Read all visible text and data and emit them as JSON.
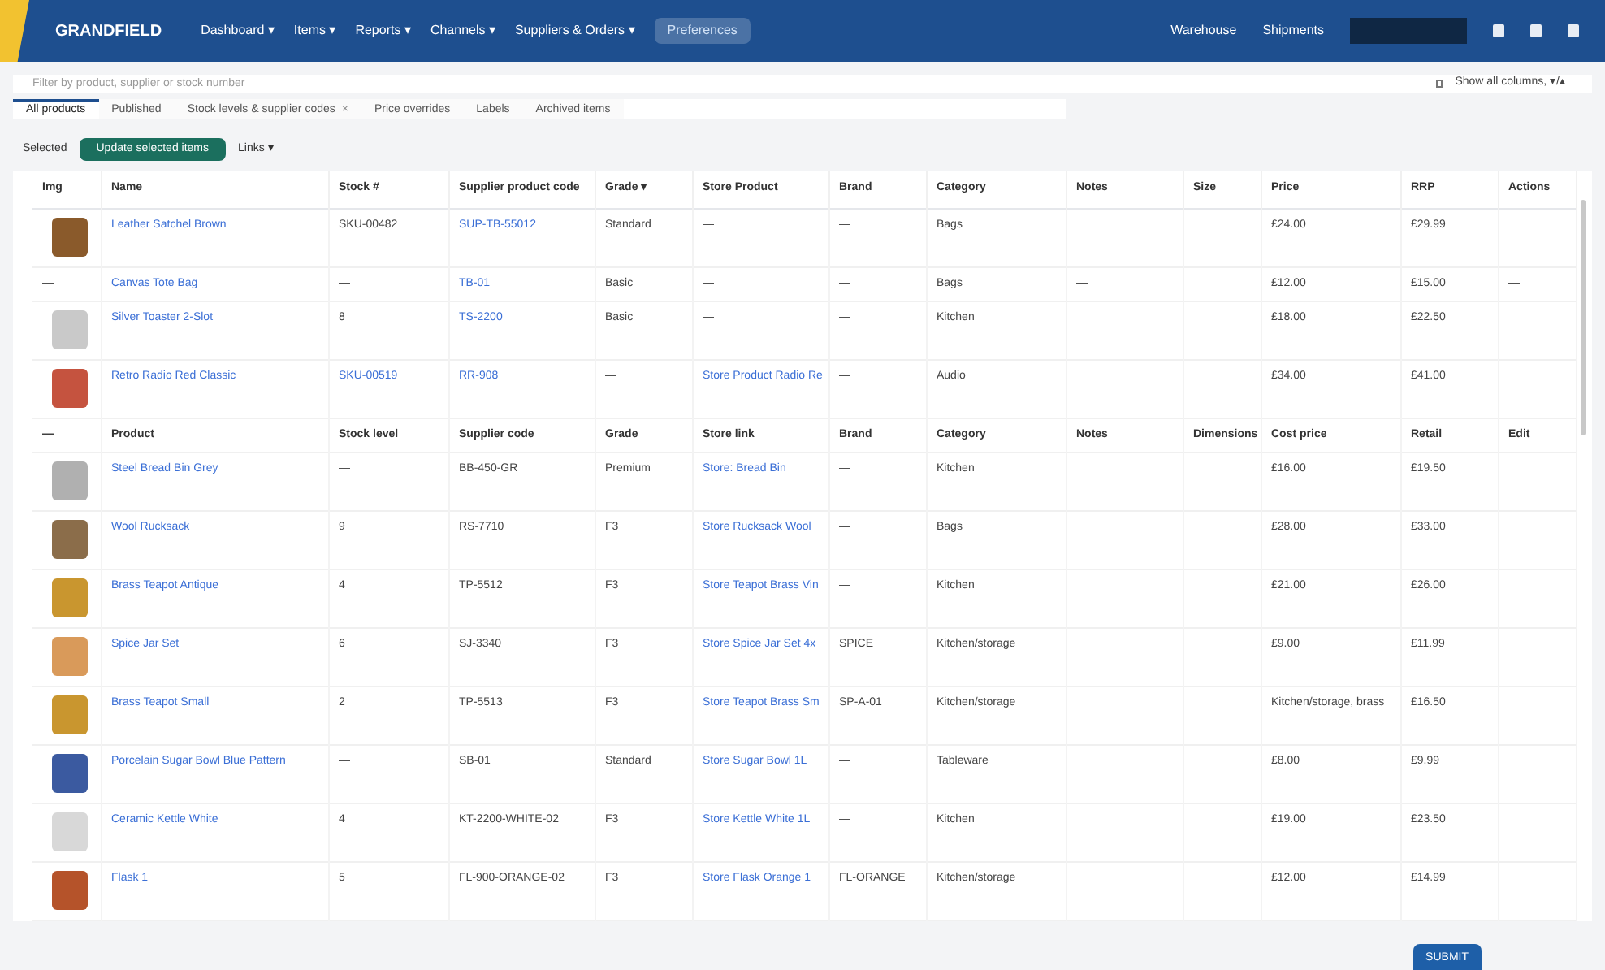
{
  "topbar": {
    "brand": "GRANDFIELD",
    "nav": [
      "Dashboard ▾",
      "Items ▾",
      "Reports ▾",
      "Channels ▾",
      "Suppliers & Orders ▾"
    ],
    "nav_pill": "Preferences",
    "links": [
      "Warehouse",
      "Shipments"
    ]
  },
  "search": {
    "placeholder": "Filter by product, supplier or stock number",
    "toggle": "Show all columns, ▾/▴"
  },
  "tabs": [
    {
      "label": "All products",
      "selected": true
    },
    {
      "label": "Published",
      "selected": false
    },
    {
      "label": "Stock levels & supplier codes",
      "selected": false,
      "close": "×"
    },
    {
      "label": "Price overrides",
      "selected": false
    },
    {
      "label": "Labels",
      "selected": false
    },
    {
      "label": "Archived items",
      "selected": false
    }
  ],
  "actions": {
    "label": "Selected",
    "button": "Update selected items",
    "menu": "Links ▾"
  },
  "table": {
    "columns": [
      "Img",
      "Name",
      "Stock #",
      "Supplier product code",
      "Grade ▾",
      "Store Product",
      "Brand",
      "Category",
      "Notes",
      "Size",
      "Price",
      "RRP",
      "Actions"
    ],
    "rows": [
      {
        "kind": "item",
        "photo": true,
        "cells": [
          null,
          {
            "text": "Leather Satchel Brown",
            "link": true
          },
          "SKU-00482",
          {
            "text": "SUP-TB-55012",
            "link": true
          },
          "Standard",
          "—",
          "—",
          "Bags",
          null,
          null,
          "£24.00",
          "£29.99",
          null
        ]
      },
      {
        "kind": "item",
        "photo": false,
        "cells": [
          "—",
          {
            "text": "Canvas Tote Bag",
            "link": true
          },
          "—",
          {
            "text": "TB-01",
            "link": true
          },
          "Basic",
          "—",
          "—",
          "Bags",
          "—",
          null,
          "£12.00",
          "£15.00",
          "—"
        ]
      },
      {
        "kind": "item",
        "photo": true,
        "cells": [
          null,
          {
            "text": "Silver Toaster 2-Slot",
            "link": true
          },
          "8",
          {
            "text": "TS-2200",
            "link": true
          },
          "Basic",
          "—",
          "—",
          "Kitchen",
          null,
          null,
          "£18.00",
          "£22.50",
          null
        ]
      },
      {
        "kind": "item",
        "photo": true,
        "cells": [
          null,
          {
            "text": "Retro Radio Red Classic",
            "link": true
          },
          {
            "text": "SKU-00519",
            "link": true
          },
          {
            "text": "RR-908",
            "link": true
          },
          "—",
          {
            "text": "Store Product Radio Re",
            "link": true
          },
          "—",
          "Audio",
          null,
          null,
          "£34.00",
          "£41.00",
          null
        ]
      },
      {
        "kind": "header",
        "photo": false,
        "cells": [
          "—",
          "Product",
          "Stock level",
          "Supplier code",
          "Grade",
          "Store link",
          "Brand",
          "Category",
          "Notes",
          "Dimensions",
          "Cost price",
          "Retail",
          "Edit"
        ]
      },
      {
        "kind": "item",
        "photo": true,
        "cells": [
          null,
          {
            "text": "Steel Bread Bin Grey",
            "link": true
          },
          "—",
          "BB-450-GR",
          "Premium",
          {
            "text": "Store: Bread Bin",
            "link": true
          },
          "—",
          "Kitchen",
          null,
          null,
          "£16.00",
          "£19.50",
          null
        ]
      },
      {
        "kind": "item",
        "photo": true,
        "cells": [
          null,
          {
            "text": "Wool Rucksack",
            "link": true
          },
          "9",
          "RS-7710",
          "F3",
          {
            "text": "Store Rucksack Wool",
            "link": true
          },
          "—",
          "Bags",
          null,
          null,
          "£28.00",
          "£33.00",
          null
        ]
      },
      {
        "kind": "item",
        "photo": true,
        "cells": [
          null,
          {
            "text": "Brass Teapot Antique",
            "link": true
          },
          "4",
          "TP-5512",
          "F3",
          {
            "text": "Store Teapot Brass Vin",
            "link": true
          },
          "—",
          "Kitchen",
          null,
          null,
          "£21.00",
          "£26.00",
          null
        ]
      },
      {
        "kind": "item",
        "photo": true,
        "cells": [
          null,
          {
            "text": "Spice Jar Set",
            "link": true
          },
          "6",
          "SJ-3340",
          "F3",
          {
            "text": "Store Spice Jar Set 4x",
            "link": true
          },
          "SPICE",
          "Kitchen/storage",
          null,
          null,
          "£9.00",
          "£11.99",
          null
        ]
      },
      {
        "kind": "item",
        "photo": true,
        "cells": [
          null,
          {
            "text": "Brass Teapot Small",
            "link": true
          },
          "2",
          "TP-5513",
          "F3",
          {
            "text": "Store Teapot Brass Sm",
            "link": true
          },
          "SP-A-01",
          "Kitchen/storage",
          null,
          null,
          "Kitchen/storage, brass",
          "£16.50",
          null
        ]
      },
      {
        "kind": "item",
        "photo": true,
        "cells": [
          null,
          {
            "text": "Porcelain Sugar Bowl Blue Pattern",
            "link": true
          },
          "—",
          "SB-01",
          "Standard",
          {
            "text": "Store Sugar Bowl 1L",
            "link": true
          },
          "—",
          "Tableware",
          null,
          null,
          "£8.00",
          "£9.99",
          null
        ]
      },
      {
        "kind": "item",
        "photo": true,
        "cells": [
          null,
          {
            "text": "Ceramic Kettle White",
            "link": true
          },
          "4",
          "KT-2200-WHITE-02",
          "F3",
          {
            "text": "Store Kettle White 1L",
            "link": true
          },
          "—",
          "Kitchen",
          null,
          null,
          "£19.00",
          "£23.50",
          null
        ]
      },
      {
        "kind": "item",
        "photo": true,
        "cells": [
          null,
          {
            "text": "Flask 1",
            "link": true
          },
          "5",
          "FL-900-ORANGE-02",
          "F3",
          {
            "text": "Store Flask Orange 1",
            "link": true
          },
          "FL-ORANGE",
          "Kitchen/storage",
          null,
          null,
          "£12.00",
          "£14.99",
          null
        ]
      }
    ]
  },
  "submit": "SUBMIT"
}
